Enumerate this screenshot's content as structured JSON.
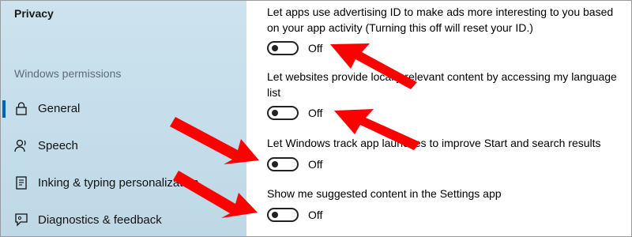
{
  "sidebar": {
    "title": "Privacy",
    "section_label": "Windows permissions",
    "items": [
      {
        "label": "General",
        "icon": "lock-icon",
        "selected": true
      },
      {
        "label": "Speech",
        "icon": "speech-icon",
        "selected": false
      },
      {
        "label": "Inking & typing personalization",
        "icon": "inking-icon",
        "selected": false
      },
      {
        "label": "Diagnostics & feedback",
        "icon": "feedback-icon",
        "selected": false
      }
    ]
  },
  "settings": [
    {
      "text": "Let apps use advertising ID to make ads more interesting to you based on your app activity (Turning this off will reset your ID.)",
      "state": "Off"
    },
    {
      "text": "Let websites provide locally relevant content by accessing my language list",
      "state": "Off"
    },
    {
      "text": "Let Windows track app launches to improve Start and search results",
      "state": "Off"
    },
    {
      "text": "Show me suggested content in the Settings app",
      "state": "Off"
    }
  ],
  "colors": {
    "accent": "#0063b1",
    "arrow": "#ff0000",
    "sidebar_bg": "#c9e0ec"
  }
}
